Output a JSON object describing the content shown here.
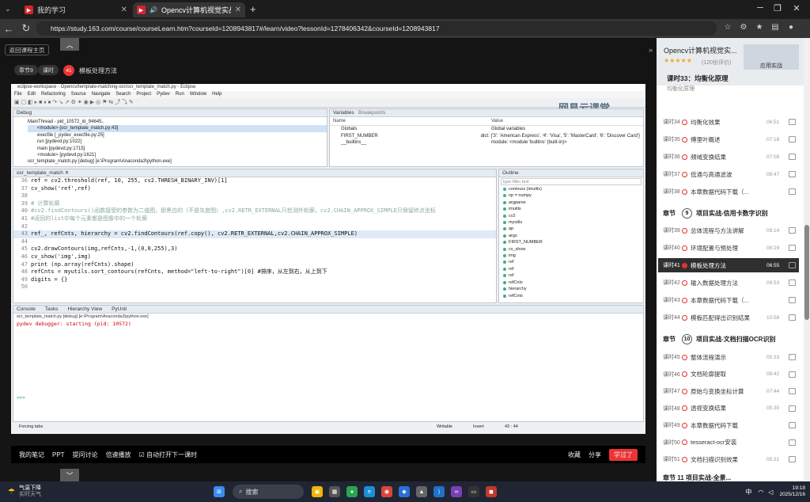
{
  "browser": {
    "tabs": [
      {
        "title": "我的学习",
        "active": false
      },
      {
        "title": "Opencv计算机视觉实战(Pyth...",
        "active": true
      }
    ],
    "new_tab": "+",
    "url": "https://study.163.com/course/courseLearn.htm?courseId=1208943817#/learn/video?lessonId=1278406342&courseId=1208943817"
  },
  "player": {
    "back_label": "返回课程主页",
    "chapter_pill": "章节9",
    "lesson_pill": "课时",
    "lesson_num": "41",
    "lesson_title": "模板处理方法",
    "watermark": "网易云课堂",
    "controls": {
      "notes": "我的笔记",
      "ppt": "PPT",
      "qa": "提问讨论",
      "rate": "倍速播放",
      "autoplay": "自动打开下一课时",
      "fav": "收藏",
      "share": "分享",
      "learned": "学过了"
    }
  },
  "ide": {
    "title": "eclipse-workspace - Opencv/template-matching-ocr/ocr_template_match.py - Eclipse",
    "menu": [
      "File",
      "Edit",
      "Refactoring",
      "Source",
      "Navigate",
      "Search",
      "Project",
      "Pydev",
      "Run",
      "Window",
      "Help"
    ],
    "debug_tab": "Debug",
    "debug_tree": [
      "MainThread - pid_10572_id_94645..",
      "<module> [ocr_template_match.py:43]",
      "execfile [_pydev_execfile.py:25]",
      "run [pydevd.py:1022]",
      "main [pydevd.py:1715]",
      "<module> [pydevd.py:1621]",
      "ocr_template_match.py [debug] [e:\\Program\\Anaconda3\\python.exe]"
    ],
    "vars_tabs": [
      "Variables",
      "Breakpoints"
    ],
    "vars_head": [
      "Name",
      "Value"
    ],
    "vars": [
      {
        "n": "Globals",
        "v": "Global variables"
      },
      {
        "n": "FIRST_NUMBER",
        "v": "dict: {'3': 'American Express', '4': 'Visa', '5': 'MasterCard', '6': 'Discover Card'}"
      },
      {
        "n": "__builtins__",
        "v": "module: <module 'builtins' (built-in)>"
      }
    ],
    "editor_tab": "ocr_template_match",
    "code": [
      {
        "n": "36",
        "t": "ref = cv2.threshold(ref, 10, 255, cv2.THRESH_BINARY_INV)[1]"
      },
      {
        "n": "37",
        "t": "cv_show('ref',ref)"
      },
      {
        "n": "38",
        "t": ""
      },
      {
        "n": "39",
        "t": "# 计算轮廓"
      },
      {
        "n": "40",
        "t": "#cv2.findContours()函数接受的参数为二值图，即黑白的（不是灰度图）,cv2.RETR_EXTERNAL只检测外轮廓，cv2.CHAIN_APPROX_SIMPLE只保留终点坐标"
      },
      {
        "n": "41",
        "t": "#返回的list中每个元素都是图像中的一个轮廓"
      },
      {
        "n": "42",
        "t": ""
      },
      {
        "n": "43",
        "t": "ref_, refCnts, hierarchy = cv2.findContours(ref.copy(), cv2.RETR_EXTERNAL,cv2.CHAIN_APPROX_SIMPLE)"
      },
      {
        "n": "44",
        "t": ""
      },
      {
        "n": "45",
        "t": "cv2.drawContours(img,refCnts,-1,(0,0,255),3)"
      },
      {
        "n": "46",
        "t": "cv_show('img',img)"
      },
      {
        "n": "47",
        "t": "print (np.array(refCnts).shape)"
      },
      {
        "n": "48",
        "t": "refCnts = myutils.sort_contours(refCnts, method=\"left-to-right\")[0] #排序，从左到右，从上到下"
      },
      {
        "n": "49",
        "t": "digits = {}"
      },
      {
        "n": "50",
        "t": ""
      }
    ],
    "outline_tab": "Outline",
    "outline_filter": "type filter text",
    "outline": [
      "contours (imutils)",
      "np = numpy",
      "argparse",
      "imutils",
      "cv2",
      "myutils",
      "ap",
      "args",
      "FIRST_NUMBER",
      "cv_show",
      "img",
      "ref",
      "ref",
      "ref",
      "refCnts",
      "hierarchy",
      "refCnts"
    ],
    "console_tabs": [
      "Console",
      "Tasks",
      "Hierarchy View",
      "PyUnit"
    ],
    "console_title": "ocr_template_match.py [debug] [e:\\Program\\Anaconda3\\python.exe]",
    "console_line": "pydev debugger: starting (pid: 10572)",
    "prompt": ">>>",
    "status": {
      "left": "Forcing tabs",
      "writable": "Writable",
      "insert": "Insert",
      "pos": "43 : 44"
    }
  },
  "sidebar": {
    "course_title": "Opencv计算机视觉实...",
    "rating": "★★★★★",
    "rating_count": "(120份评价)",
    "thumb": "应用实战",
    "current": "课时33：均衡化原理",
    "current_sub": "均衡化原理",
    "items": [
      {
        "k": "课时34",
        "t": "均衡化效果",
        "d": "06:51"
      },
      {
        "k": "课时35",
        "t": "傅里叶概述",
        "d": "07:18"
      },
      {
        "k": "课时36",
        "t": "频域变换结果",
        "d": "07:08"
      },
      {
        "k": "课时37",
        "t": "低通与高通滤波",
        "d": "08:47"
      },
      {
        "k": "课时38",
        "t": "本章数据代码下载（...",
        "d": ""
      }
    ],
    "chap9": {
      "label": "章节",
      "num": "9",
      "title": "项目实战-信用卡数字识别"
    },
    "items9": [
      {
        "k": "课时39",
        "t": "总体流程与方法讲解",
        "d": "09:14"
      },
      {
        "k": "课时40",
        "t": "环境配置与预处理",
        "d": "08:29"
      },
      {
        "k": "课时41",
        "t": "模板处理方法",
        "d": "06:55",
        "active": true
      },
      {
        "k": "课时42",
        "t": "输入数据处理方法",
        "d": "09:53"
      },
      {
        "k": "课时43",
        "t": "本章数据代码下载（...",
        "d": ""
      },
      {
        "k": "课时44",
        "t": "模板匹配得出识别结果",
        "d": "10:58"
      }
    ],
    "chap10": {
      "label": "章节",
      "num": "10",
      "title": "项目实战-文档扫描OCR识别"
    },
    "items10": [
      {
        "k": "课时45",
        "t": "整体流程演示",
        "d": "05:33"
      },
      {
        "k": "课时46",
        "t": "文档轮廓提取",
        "d": "08:42"
      },
      {
        "k": "课时47",
        "t": "原始与变换坐标计算",
        "d": "07:44"
      },
      {
        "k": "课时48",
        "t": "透视变换结果",
        "d": "05:30"
      },
      {
        "k": "课时49",
        "t": "本章数据代码下载",
        "d": ""
      },
      {
        "k": "课时50",
        "t": "tesseract-ocr安装",
        "d": ""
      },
      {
        "k": "课时51",
        "t": "文档扫描识别效果",
        "d": "05:31"
      }
    ],
    "chap11": "章节 11 项目实战-全景..."
  },
  "taskbar": {
    "weather": "气温下降",
    "weather_sub": "实时天气",
    "search": "搜索",
    "lang": "中",
    "time": "19:18",
    "date": "2025/12/16"
  }
}
